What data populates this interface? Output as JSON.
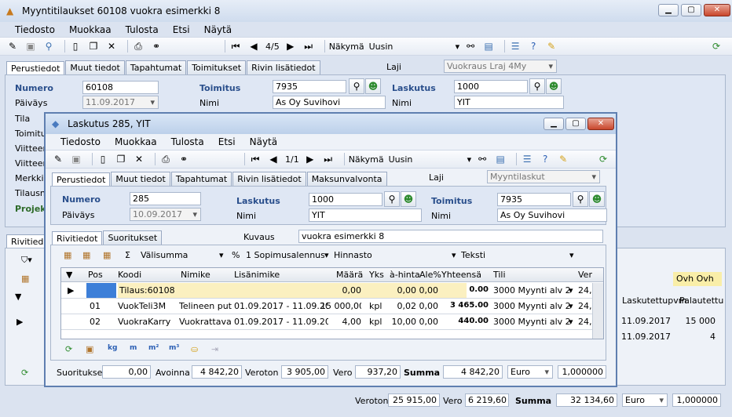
{
  "main": {
    "title": "Myyntitilaukset 60108 vuokra esimerkki 8",
    "menu": [
      "Tiedosto",
      "Muokkaa",
      "Tulosta",
      "Etsi",
      "Näytä"
    ],
    "toolbar": {
      "record": "4/5",
      "view_label": "Näkymä",
      "view_value": "Uusin"
    },
    "tabs": [
      "Perustiedot",
      "Muut tiedot",
      "Tapahtumat",
      "Toimitukset",
      "Rivin lisätiedot"
    ],
    "laji_label": "Laji",
    "laji_value": "Vuokraus Lraj 4My",
    "numero_label": "Numero",
    "numero": "60108",
    "paivays_label": "Päiväys",
    "paivays": "11.09.2017",
    "toimitus_label": "Toimitus",
    "toimitus": "7935",
    "nimi_label": "Nimi",
    "toimitus_nimi": "As Oy Suvihovi",
    "laskutus_label": "Laskutus",
    "laskutus": "1000",
    "laskutus_nimi": "YIT",
    "left_labels": [
      "Tila",
      "Toimitus",
      "Viitteen",
      "Viitteen",
      "Merkki",
      "Tilausnu",
      "Projekt"
    ],
    "lower_tab": "Rivitiedot",
    "right_cols": {
      "ovh": "Ovh Ovh",
      "laskutettu": "Laskutettupvm",
      "palautettu": "Palautettu"
    },
    "right_rows": [
      {
        "pvm": "11.09.2017",
        "pal": "15 000"
      },
      {
        "pvm": "11.09.2017",
        "pal": "4"
      }
    ],
    "footer": {
      "veroton_label": "Veroton",
      "veroton": "25 915,00",
      "vero_label": "Vero",
      "vero": "6 219,60",
      "summa_label": "Summa",
      "summa": "32 134,60",
      "currency": "Euro",
      "rate": "1,000000"
    }
  },
  "dialog": {
    "title": "Laskutus 285, YIT",
    "menu": [
      "Tiedosto",
      "Muokkaa",
      "Tulosta",
      "Etsi",
      "Näytä"
    ],
    "toolbar": {
      "record": "1/1",
      "view_label": "Näkymä",
      "view_value": "Uusin"
    },
    "tabs": [
      "Perustiedot",
      "Muut tiedot",
      "Tapahtumat",
      "Rivin lisätiedot",
      "Maksunvalvonta"
    ],
    "laji_label": "Laji",
    "laji_value": "Myyntilaskut",
    "numero_label": "Numero",
    "numero": "285",
    "paivays_label": "Päiväys",
    "paivays": "10.09.2017",
    "laskutus_label": "Laskutus",
    "laskutus": "1000",
    "nimi_label": "Nimi",
    "laskutus_nimi": "YIT",
    "toimitus_label": "Toimitus",
    "toimitus": "7935",
    "toimitus_nimi": "As Oy Suvihovi",
    "lower_tabs": [
      "Rivitiedot",
      "Suoritukset"
    ],
    "kuvaus_label": "Kuvaus",
    "kuvaus": "vuokra esimerkki 8",
    "grid_toolbar": {
      "valisumma": "Välisumma",
      "percent": "%",
      "alennus": "1 Sopimusalennus",
      "hinnasto": "Hinnasto",
      "teksti": "Teksti"
    },
    "columns": [
      "Pos",
      "Koodi",
      "Nimike",
      "Lisänimike",
      "Määrä",
      "Yks",
      "à-hinta",
      "Ale%",
      "Yhteensä",
      "Tili",
      "Ver"
    ],
    "rows": [
      {
        "pos": "",
        "koodi": "Tilaus:60108",
        "nimike": "",
        "lisa": "",
        "maara": "0,00",
        "yks": "",
        "hinta": "0,00",
        "ale": "0,00",
        "yht": "0.00",
        "tili": "3000 Myynti alv 2...",
        "ver": "24,"
      },
      {
        "pos": "01",
        "koodi": "VuokTeli3M",
        "nimike": "Telineen putki ...",
        "lisa": "01.09.2017 - 11.09.2017",
        "maara": "15 000,00",
        "yks": "kpl",
        "hinta": "0,02",
        "ale": "0,00",
        "yht": "3 465.00",
        "tili": "3000 Myynti alv 2...",
        "ver": "24,"
      },
      {
        "pos": "02",
        "koodi": "VuokraKarry",
        "nimike": "Vuokrattava P...",
        "lisa": "01.09.2017 - 11.09.2017",
        "maara": "4,00",
        "yks": "kpl",
        "hinta": "10,00",
        "ale": "0,00",
        "yht": "440.00",
        "tili": "3000 Myynti alv 2...",
        "ver": "24,"
      }
    ],
    "bottom_icons": [
      "kg",
      "m",
      "m²",
      "m³"
    ],
    "footer": {
      "suoritukset_label": "Suoritukset",
      "suoritukset": "0,00",
      "avoinna_label": "Avoinna",
      "avoinna": "4 842,20",
      "veroton_label": "Veroton",
      "veroton": "3 905,00",
      "vero_label": "Vero",
      "vero": "937,20",
      "summa_label": "Summa",
      "summa": "4 842,20",
      "currency": "Euro",
      "rate": "1,000000"
    }
  }
}
